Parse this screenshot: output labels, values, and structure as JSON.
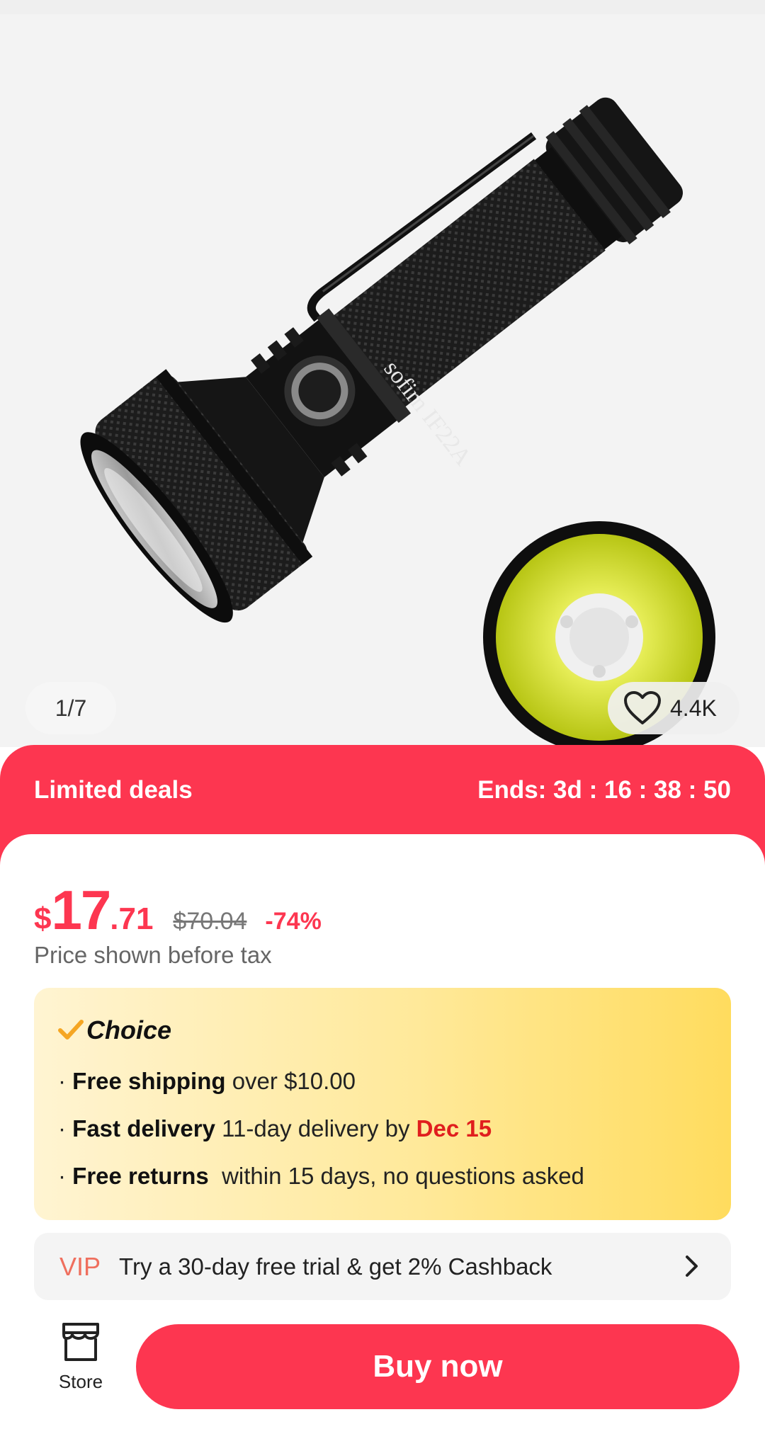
{
  "gallery": {
    "counter": "1/7",
    "favorites_count": "4.4K",
    "brand_engraving": "sofirn IF22A"
  },
  "deals": {
    "title": "Limited deals",
    "timer": "Ends: 3d : 16 : 38 : 50"
  },
  "price": {
    "currency": "$",
    "integer": "17",
    "decimal": ".71",
    "original": "$70.04",
    "discount": "-74%",
    "tax_note": "Price shown before tax"
  },
  "choice": {
    "label": "Choice",
    "benefits": [
      {
        "bullet": "· ",
        "bold": "Free shipping",
        "text": " over $10.00"
      },
      {
        "bullet": "· ",
        "bold": "Fast delivery",
        "text": " 11-day delivery by ",
        "highlight": "Dec 15"
      },
      {
        "bullet": "· ",
        "bold": "Free returns",
        "text": "  within 15 days, no questions asked"
      }
    ]
  },
  "vip": {
    "tag": "VIP",
    "text": "Try a 30-day free trial & get 2% Cashback"
  },
  "bottom_bar": {
    "store_label": "Store",
    "buy_label": "Buy now"
  },
  "colors": {
    "accent": "#fd3650",
    "highlight_red": "#e01e1e",
    "choice_gradient_start": "#fff4d2",
    "choice_gradient_end": "#ffdc5e",
    "vip_tag": "#ef6f5e"
  },
  "icons": {
    "favorite": "heart-outline-icon",
    "vip_arrow": "chevron-right-icon",
    "store": "store-icon",
    "choice_check": "checkmark-icon"
  }
}
